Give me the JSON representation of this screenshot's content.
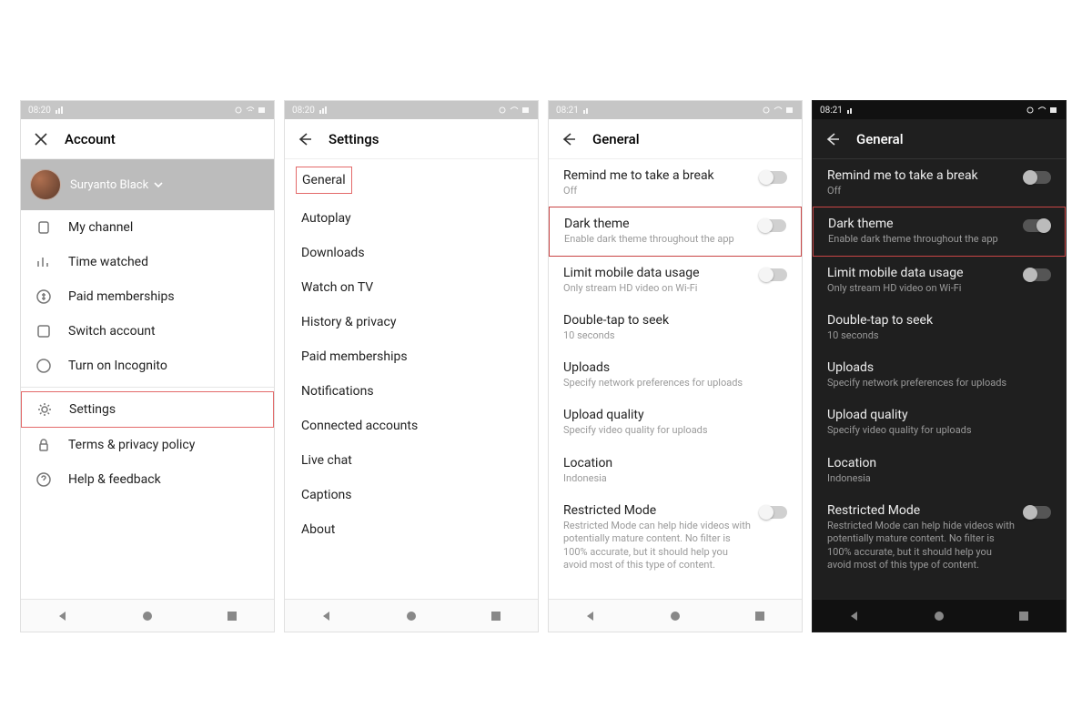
{
  "phones": [
    {
      "time": "08:20",
      "header": "Account",
      "user": "Suryanto Black",
      "items": [
        {
          "label": "My channel"
        },
        {
          "label": "Time watched"
        },
        {
          "label": "Paid memberships"
        },
        {
          "label": "Switch account"
        },
        {
          "label": "Turn on Incognito"
        }
      ],
      "secondary": [
        {
          "label": "Settings",
          "highlight": true
        },
        {
          "label": "Terms & privacy policy"
        },
        {
          "label": "Help & feedback"
        }
      ]
    },
    {
      "time": "08:20",
      "header": "Settings",
      "settings": [
        {
          "label": "General",
          "highlight": true
        },
        {
          "label": "Autoplay"
        },
        {
          "label": "Downloads"
        },
        {
          "label": "Watch on TV"
        },
        {
          "label": "History & privacy"
        },
        {
          "label": "Paid memberships"
        },
        {
          "label": "Notifications"
        },
        {
          "label": "Connected accounts"
        },
        {
          "label": "Live chat"
        },
        {
          "label": "Captions"
        },
        {
          "label": "About"
        }
      ]
    },
    {
      "time": "08:21",
      "header": "General",
      "general": [
        {
          "title": "Remind me to take a break",
          "sub": "Off",
          "toggle": "off"
        },
        {
          "title": "Dark theme",
          "sub": "Enable dark theme throughout the app",
          "toggle": "off",
          "highlight": true
        },
        {
          "title": "Limit mobile data usage",
          "sub": "Only stream HD video on Wi-Fi",
          "toggle": "off"
        },
        {
          "title": "Double-tap to seek",
          "sub": "10 seconds"
        },
        {
          "title": "Uploads",
          "sub": "Specify network preferences for uploads"
        },
        {
          "title": "Upload quality",
          "sub": "Specify video quality for uploads"
        },
        {
          "title": "Location",
          "sub": "Indonesia"
        },
        {
          "title": "Restricted Mode",
          "sub": "Restricted Mode can help hide videos with potentially mature content. No filter is 100% accurate, but it should help you avoid most of this type of content.",
          "toggle": "off"
        }
      ]
    },
    {
      "time": "08:21",
      "header": "General",
      "dark": true,
      "general": [
        {
          "title": "Remind me to take a break",
          "sub": "Off",
          "toggle": "off"
        },
        {
          "title": "Dark theme",
          "sub": "Enable dark theme throughout the app",
          "toggle": "on",
          "highlight": true
        },
        {
          "title": "Limit mobile data usage",
          "sub": "Only stream HD video on Wi-Fi",
          "toggle": "off"
        },
        {
          "title": "Double-tap to seek",
          "sub": "10 seconds"
        },
        {
          "title": "Uploads",
          "sub": "Specify network preferences for uploads"
        },
        {
          "title": "Upload quality",
          "sub": "Specify video quality for uploads"
        },
        {
          "title": "Location",
          "sub": "Indonesia"
        },
        {
          "title": "Restricted Mode",
          "sub": "Restricted Mode can help hide videos with potentially mature content. No filter is 100% accurate, but it should help you avoid most of this type of content.",
          "toggle": "off"
        }
      ]
    }
  ]
}
